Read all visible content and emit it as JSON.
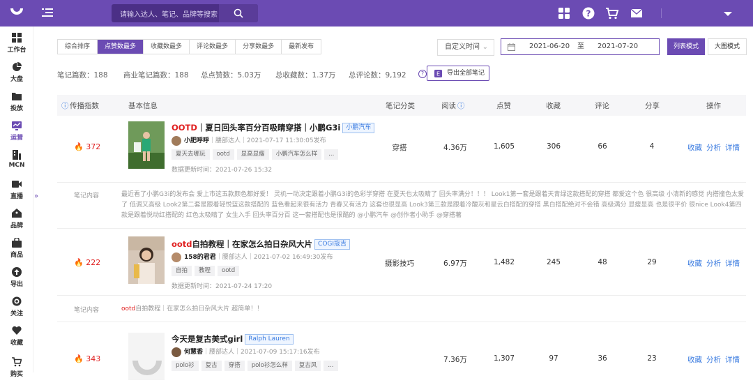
{
  "search": {
    "placeholder": "请输入达人、笔记、品牌等搜索"
  },
  "sidebar": {
    "items": [
      {
        "label": "工作台",
        "icon": "grid-icon"
      },
      {
        "label": "大盘",
        "icon": "pie-icon"
      },
      {
        "label": "投放",
        "icon": "folder-icon"
      },
      {
        "label": "运营",
        "icon": "chart-icon",
        "active": true
      },
      {
        "label": "MCN",
        "icon": "building-icon"
      },
      {
        "label": "直播",
        "icon": "video-icon"
      },
      {
        "label": "品牌",
        "icon": "tag-icon"
      },
      {
        "label": "商品",
        "icon": "bag-icon"
      },
      {
        "label": "导出",
        "icon": "upload-icon"
      },
      {
        "label": "关注",
        "icon": "eye-icon"
      },
      {
        "label": "收藏",
        "icon": "heart-icon"
      },
      {
        "label": "购买",
        "icon": "cart-icon"
      }
    ]
  },
  "sort_tabs": [
    "综合排序",
    "点赞数最多",
    "收藏数最多",
    "评论数最多",
    "分享数最多",
    "最新发布"
  ],
  "time_select": "自定义时间",
  "date_range": {
    "start": "2021-06-20",
    "sep": "至",
    "end": "2021-07-20"
  },
  "view_buttons": {
    "list": "列表模式",
    "grid": "大图模式"
  },
  "stats": {
    "notes": "笔记篇数：188",
    "commercial": "商业笔记篇数：188",
    "likes": "总点赞数：5.03万",
    "collects": "总收藏数：1.37万",
    "comments": "总评论数：9,192"
  },
  "export_label": "导出全部笔记",
  "table_headers": {
    "index": "传播指数",
    "info": "基本信息",
    "category": "笔记分类",
    "reads": "阅读",
    "likes": "点赞",
    "collects": "收藏",
    "comments": "评论",
    "shares": "分享",
    "ops": "操作"
  },
  "ops": {
    "collect": "收藏",
    "analyze": "分析",
    "detail": "详情"
  },
  "content_label": "笔记内容",
  "notes": [
    {
      "heat": "372",
      "title_hl": "OOTD",
      "title_rest": "｜夏日回头率百分百吸睛穿搭｜小鹏G3i",
      "brand": "小鹏汽车",
      "author": "小肥呼呼",
      "level": "｜腰部达人｜",
      "time": "2021-07-17 11:30:05发布",
      "tags": [
        "夏天去哪玩",
        "ootd",
        "显高显瘦",
        "小鹏汽车怎么样",
        "..."
      ],
      "updated": "数据更新时间：2021-07-26 15:32",
      "category": "穿搭",
      "reads": "4.36万",
      "likes": "1,605",
      "collects": "306",
      "comments": "66",
      "shares": "4",
      "content": "最近看了小鹏G3i的发布会 爱上市这五款颜色都好爱！ 灵机一动决定跟着小鹏G3i的色彩学穿搭 在夏天也太吸睛了 回头率满分！！！ Look1第一套是跟着天青绿这款搭配的穿搭 都爱这个色 很高级 小清新的感觉 内搭撞色太爱了 低调又高级 Look2第二套是跟着轻悦蓝这款搭配的 蓝色看起来很有活力 青春又有活力 这套也很显高 Look3第三款是跟着冷酸灰和星云白搭配的穿搭 黑白搭配绝对不会错 高级满分 显瘦显高 也是很平价 很nice Look4第四款是跟着悦动红搭配的 红色太吸睛了 女生入手 回头率百分百 这一套搭配也是很酷的 @小鹏汽车 @创作者小助手 @穿搭薯",
      "content_hl": ""
    },
    {
      "heat": "222",
      "title_hl": "ootd",
      "title_rest": "自拍教程｜在家怎么拍日杂风大片",
      "brand": "COGI寇吉",
      "author": "158的君君",
      "level": "｜腰部达人｜",
      "time": "2021-07-02 16:49:30发布",
      "tags": [
        "自拍",
        "教程",
        "ootd"
      ],
      "updated": "数据更新时间：2021-07-24 17:20",
      "category": "摄影技巧",
      "reads": "6.97万",
      "likes": "1,482",
      "collects": "245",
      "comments": "48",
      "shares": "29",
      "content": "自拍教程｜在家怎么拍日杂风大片 超简单！！",
      "content_hl": "ootd"
    },
    {
      "heat": "343",
      "title_hl": "",
      "title_rest": "今天是复古美式girl",
      "brand": "Ralph Lauren",
      "author": "何慧香",
      "level": "｜腰部达人｜",
      "time": "2021-07-09 15:17:16发布",
      "tags": [
        "polo衫",
        "复古",
        "穿搭",
        "polo衫怎么样",
        "复古风",
        "..."
      ],
      "updated": "",
      "category": "",
      "reads": "7.36万",
      "likes": "1,307",
      "collects": "97",
      "comments": "36",
      "shares": "23",
      "content": "",
      "content_hl": ""
    }
  ]
}
